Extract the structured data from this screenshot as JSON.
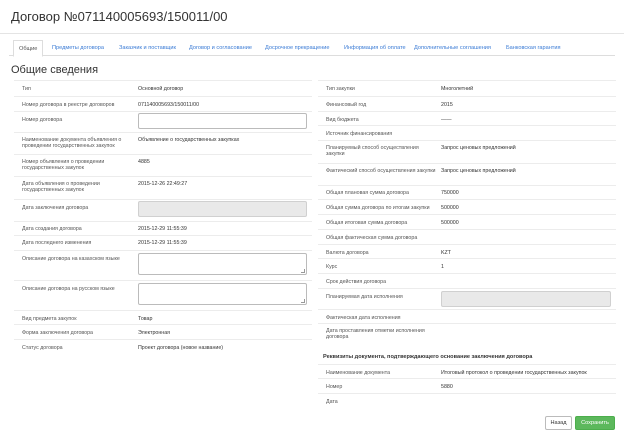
{
  "header": {
    "title": "Договор №071140005693/150011/00"
  },
  "tabs": [
    {
      "label": "Общие",
      "active": true
    },
    {
      "label": "Предметы договора"
    },
    {
      "label": "Заказчик и поставщик"
    },
    {
      "label": "Договор и согласование"
    },
    {
      "label": "Досрочное прекращение"
    },
    {
      "label": "Информация об оплате"
    },
    {
      "label": "Дополнительные соглашения"
    },
    {
      "label": "Банковская гарантия"
    }
  ],
  "section": {
    "title": "Общие сведения"
  },
  "left": {
    "type": {
      "label": "Тип",
      "value": "Основной договор"
    },
    "registry_number": {
      "label": "Номер договора в реестре договоров",
      "value": "071140005693/150011/00"
    },
    "contract_number": {
      "label": "Номер договора",
      "value": ""
    },
    "announcement_name": {
      "label": "Наименование документа объявления о проведении государственных закупок",
      "value": "Объявление о государственных закупках"
    },
    "announcement_number": {
      "label": "Номер объявления о проведении государственных закупок",
      "value": "4885"
    },
    "announcement_date": {
      "label": "Дата объявления о проведении государственных закупок",
      "value": "2015-12-26 22:49:27"
    },
    "conclusion_date": {
      "label": "Дата заключения договора",
      "value": ""
    },
    "created_date": {
      "label": "Дата создания договора",
      "value": "2015-12-29 11:55:39"
    },
    "modified_date": {
      "label": "Дата последнего изменения",
      "value": "2015-12-29 11:55:39"
    },
    "desc_kz": {
      "label": "Описание договора на казахском языке",
      "value": ""
    },
    "desc_ru": {
      "label": "Описание договора на русском языке",
      "value": ""
    },
    "subject_type": {
      "label": "Вид предмета закупок",
      "value": "Товар"
    },
    "form": {
      "label": "Форма заключения договора",
      "value": "Электронная"
    },
    "status": {
      "label": "Статус договора",
      "value": "Проект договора (новое название)"
    }
  },
  "right": {
    "purchase_type": {
      "label": "Тип закупки",
      "value": "Многолетний"
    },
    "fiscal_year": {
      "label": "Финансовый год",
      "value": "2015"
    },
    "budget_type": {
      "label": "Вид бюджета",
      "value": "——"
    },
    "funding_source": {
      "label": "Источник финансирования",
      "value": ""
    },
    "planned_method": {
      "label": "Планируемый способ осуществления закупки",
      "value": "Запрос ценовых предложений"
    },
    "actual_method": {
      "label": "Фактический способ осуществления закупки",
      "value": "Запрос ценовых предложений"
    },
    "planned_sum": {
      "label": "Общая плановая сумма договора",
      "value": "750000"
    },
    "sum_by_results": {
      "label": "Общая сумма договора по итогам закупки",
      "value": "500000"
    },
    "final_sum": {
      "label": "Общая итоговая сумма договора",
      "value": "500000"
    },
    "actual_sum": {
      "label": "Общая фактическая сумма договора",
      "value": ""
    },
    "currency": {
      "label": "Валюта договора",
      "value": "KZT"
    },
    "rate": {
      "label": "Курс",
      "value": "1"
    },
    "validity": {
      "label": "Срок действия договора",
      "value": ""
    },
    "planned_exec_date": {
      "label": "Планируемая дата исполнения",
      "value": ""
    },
    "actual_exec_date": {
      "label": "Фактическая дата исполнения",
      "value": ""
    },
    "exec_mark_date": {
      "label": "Дата проставления отметки исполнения договора",
      "value": ""
    },
    "basis_title": "Реквизиты документа, подтверждающего основание заключения договора",
    "doc_name": {
      "label": "Наименование документа",
      "value": "Итоговый протокол о проведении государственных закупок"
    },
    "doc_number": {
      "label": "Номер",
      "value": "5880"
    },
    "doc_date": {
      "label": "Дата",
      "value": ""
    }
  },
  "buttons": {
    "back": "Назад",
    "save": "Сохранить"
  }
}
